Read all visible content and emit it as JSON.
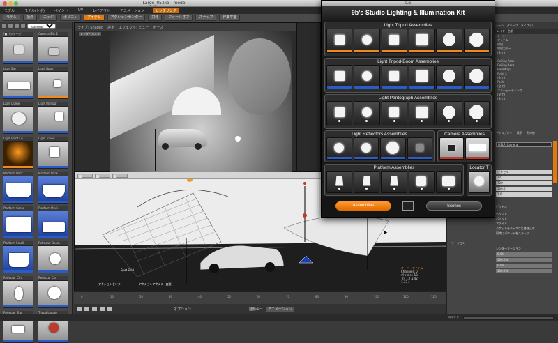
{
  "window": {
    "title": "Large_05.lxo - modo"
  },
  "menubar": {
    "items": [
      {
        "label": "モデル"
      },
      {
        "label": "モデル(トポ)"
      },
      {
        "label": "ペイント"
      },
      {
        "label": "UV"
      },
      {
        "label": "レイアウト"
      },
      {
        "label": "アニメーション"
      },
      {
        "label": "レンダリング",
        "active": true
      }
    ]
  },
  "toolbar": {
    "buttons": [
      {
        "label": "モデル"
      },
      {
        "label": "頂点"
      },
      {
        "label": "エッジ"
      },
      {
        "label": "ポリゴン"
      },
      {
        "label": "アイテム",
        "active": true
      },
      {
        "label": "アクションセンター"
      },
      {
        "label": "対称"
      },
      {
        "label": "フォールオフ"
      },
      {
        "label": "スナップ"
      },
      {
        "label": "作業平面"
      }
    ]
  },
  "sidebar": {
    "dropdown": "Assemblie",
    "items": [
      {
        "label": "[■パッケージ]"
      },
      {
        "label": "Camera Slik 2"
      },
      {
        "label": "Light Bar"
      },
      {
        "label": "Light Boom"
      },
      {
        "label": "Light Dome"
      },
      {
        "label": "Light Pantogr"
      },
      {
        "label": "Light Point Ce"
      },
      {
        "label": "Light Tripod"
      },
      {
        "label": "Platform Back"
      },
      {
        "label": "Platform Back"
      },
      {
        "label": "Platform Corne"
      },
      {
        "label": "Platform Medi"
      },
      {
        "label": "Platform Small"
      },
      {
        "label": "Reflector Boom"
      },
      {
        "label": "Reflector Circ"
      },
      {
        "label": "Reflector Cur"
      },
      {
        "label": "Reflector Trip"
      },
      {
        "label": "Tripod Locato"
      }
    ]
  },
  "viewport_top": {
    "header": [
      "ライブ: Shaded",
      "設定",
      "エフェクト: ビュー",
      "ボーズ"
    ],
    "camera_label": "レンダーカメラ"
  },
  "viewport_bottom": {
    "header": [
      "■",
      "■",
      "■"
    ],
    "annotations": [
      "アクションセンター",
      "アクションアクシス (自動)",
      "Spot Grid",
      "オーバーアイテム",
      "Channels: 0",
      "ポリゴン: 18",
      "Tri: 1.7.1.42",
      "1.33 s"
    ]
  },
  "timeline": {
    "ticks": [
      "0",
      "10",
      "20",
      "30",
      "40",
      "50",
      "60",
      "70",
      "80",
      "90",
      "100",
      "110",
      "120"
    ]
  },
  "playbar": {
    "options_label": "オプション...",
    "autokey_label": "自動キー",
    "animation_label": "アニメーション"
  },
  "right_panel": {
    "tabs": [
      "シーン",
      "グループ",
      "ライブラリ"
    ],
    "header": "レイヤー名前",
    "rows": [
      "シーン",
      "アイテム",
      "環境",
      "物理カラー",
      "(全て)",
      "",
      "Ceiling Asse",
      "Ceiling Asse",
      "Backdrop",
      "Point 2",
      "(全て)",
      "Point",
      "(全て)",
      "フルシェーディング",
      "(全て)",
      "(全て)"
    ],
    "tabs2": [
      "ディスプレイ",
      "表示",
      "その他"
    ],
    "camera_field": "DSLR_Camera",
    "fields": [
      "ピクセル",
      "72",
      "720",
      "100.0",
      "1.0"
    ],
    "labels2": [
      "ピクセル",
      "ペイント",
      "パケット",
      "ファイル",
      "パケットをディスクに書き込む",
      "同時にパケットをスキップ",
      "リージョン",
      "レンダーリージョン"
    ],
    "region_values": [
      "0.0%",
      "100.0%",
      "0.0%",
      "100.0%"
    ]
  },
  "command": {
    "label": "コマンド"
  },
  "slik": {
    "window_title": "SLIK",
    "heading": "9b's Studio Lighting & Illumination Kit",
    "sections": [
      {
        "title": "Light Tripod Assemblies",
        "count": 6
      },
      {
        "title": "Light Tripod-Boom Assemblies",
        "count": 6
      },
      {
        "title": "Light Pantograph Assemblies",
        "count": 6
      },
      {
        "title": "Light Reflectors Assemblies",
        "count": 4
      },
      {
        "title": "Camera Assemblies",
        "count": 2
      },
      {
        "title": "Platform Assemblies",
        "count": 5
      },
      {
        "title": "Locator T",
        "count": 1
      }
    ],
    "assemblies_button": "Assemblies",
    "scenes_button": "Scenes"
  }
}
